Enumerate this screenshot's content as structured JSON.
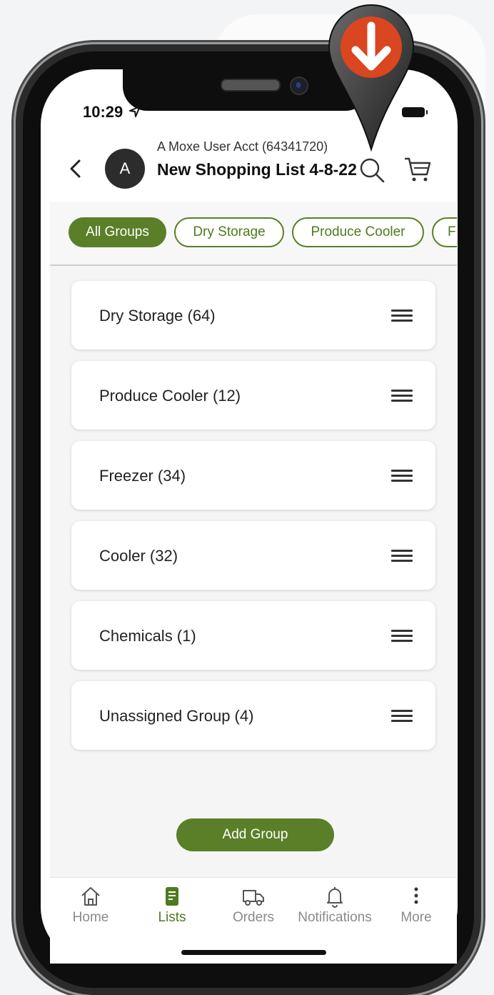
{
  "status_bar": {
    "time": "10:29"
  },
  "header": {
    "account": "A Moxe User Acct (64341720)",
    "avatar_initial": "A",
    "title": "New Shopping List 4-8-22"
  },
  "chips": [
    {
      "label": "All Groups",
      "active": true
    },
    {
      "label": "Dry Storage",
      "active": false
    },
    {
      "label": "Produce Cooler",
      "active": false
    },
    {
      "label": "F",
      "active": false
    }
  ],
  "groups": [
    {
      "label": "Dry Storage (64)"
    },
    {
      "label": "Produce Cooler (12)"
    },
    {
      "label": "Freezer (34)"
    },
    {
      "label": "Cooler (32)"
    },
    {
      "label": "Chemicals (1)"
    },
    {
      "label": "Unassigned Group (4)"
    }
  ],
  "actions": {
    "add_group": "Add Group"
  },
  "tabs": [
    {
      "label": "Home",
      "icon": "home-icon"
    },
    {
      "label": "Lists",
      "icon": "list-icon",
      "active": true
    },
    {
      "label": "Orders",
      "icon": "truck-icon"
    },
    {
      "label": "Notifications",
      "icon": "bell-icon"
    },
    {
      "label": "More",
      "icon": "more-icon"
    }
  ],
  "colors": {
    "accent": "#5a7f28",
    "pin": "#d9461f"
  }
}
